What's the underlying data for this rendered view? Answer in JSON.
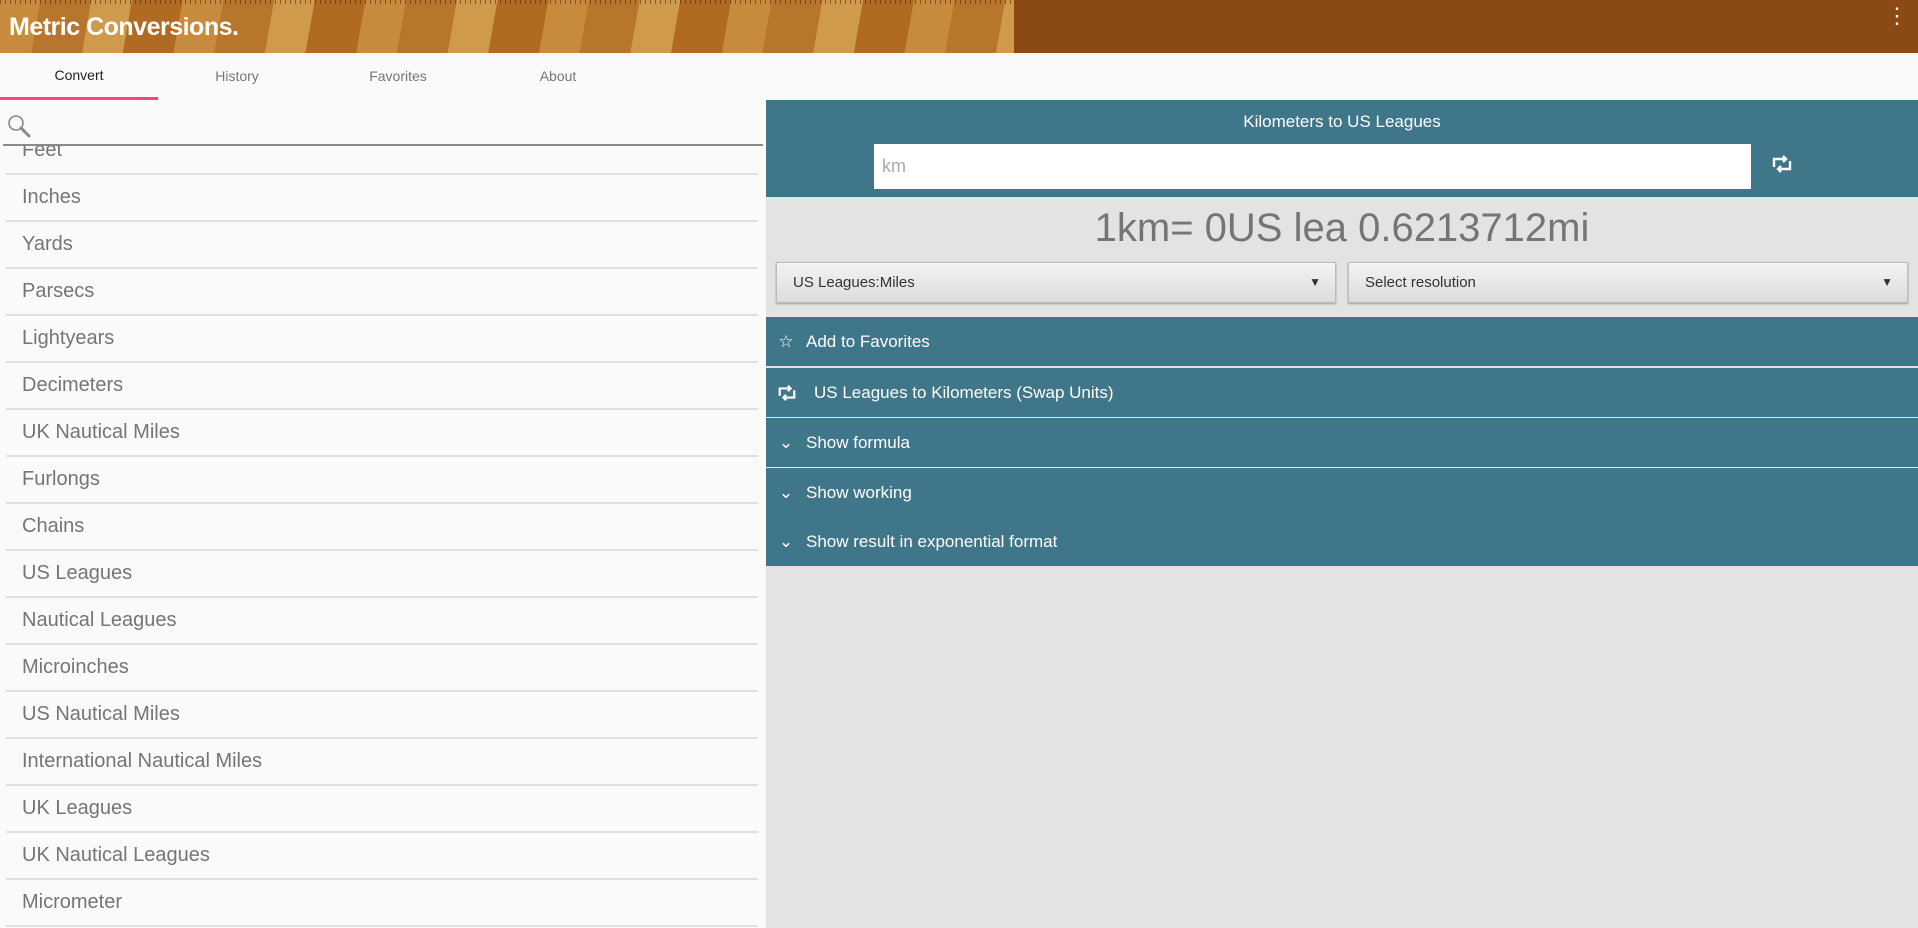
{
  "header": {
    "title": "Metric Conversions.",
    "menu_icon": "more-vert-icon",
    "brand_color": "#8b4a14"
  },
  "tabs": [
    {
      "label": "Convert",
      "active": true
    },
    {
      "label": "History"
    },
    {
      "label": "Favorites"
    },
    {
      "label": "About"
    }
  ],
  "search": {
    "placeholder": "",
    "value": ""
  },
  "units": [
    "Feet",
    "Inches",
    "Yards",
    "Parsecs",
    "Lightyears",
    "Decimeters",
    "UK Nautical Miles",
    "Furlongs",
    "Chains",
    "US Leagues",
    "Nautical Leagues",
    "Microinches",
    "US Nautical Miles",
    "International Nautical Miles",
    "UK Leagues",
    "UK Nautical Leagues",
    "Micrometer"
  ],
  "converter": {
    "title": "Kilometers to US Leagues",
    "input_placeholder": "km",
    "input_value": "",
    "result": "1km= 0US lea 0.6213712mi",
    "format_select": "US Leagues:Miles",
    "resolution_select": "Select resolution",
    "accent_color": "#3f7689"
  },
  "actions": [
    {
      "label": "Add to Favorites",
      "icon": "star-outline-icon"
    },
    {
      "label": "US Leagues to Kilometers (Swap Units)",
      "icon": "swap-icon"
    },
    {
      "label": "Show formula",
      "icon": "chevron-down-icon"
    },
    {
      "label": "Show working",
      "icon": "chevron-down-icon"
    },
    {
      "label": "Show result in exponential format",
      "icon": "chevron-down-icon"
    }
  ]
}
